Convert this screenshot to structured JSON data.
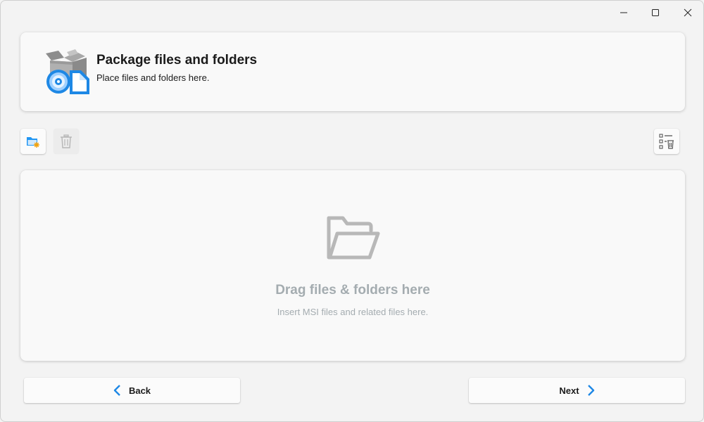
{
  "window": {
    "controls": [
      "minimize-icon",
      "maximize-icon",
      "close-icon"
    ]
  },
  "header": {
    "title": "Package files and folders",
    "subtitle": "Place files and folders here.",
    "icon": "package-files-icon"
  },
  "toolbar": {
    "add_icon": "add-folder-icon",
    "delete_icon": "trash-icon",
    "delete_disabled": true,
    "list_delete_icon": "list-delete-icon"
  },
  "drop_zone": {
    "title": "Drag files & folders here",
    "subtitle": "Insert MSI files and related files here.",
    "icon": "open-folder-icon"
  },
  "navigation": {
    "back_label": "Back",
    "next_label": "Next"
  },
  "colors": {
    "accent": "#1e88e5",
    "background": "#f3f3f3",
    "card": "#f9f9f9",
    "muted_text": "#a4acb0"
  }
}
